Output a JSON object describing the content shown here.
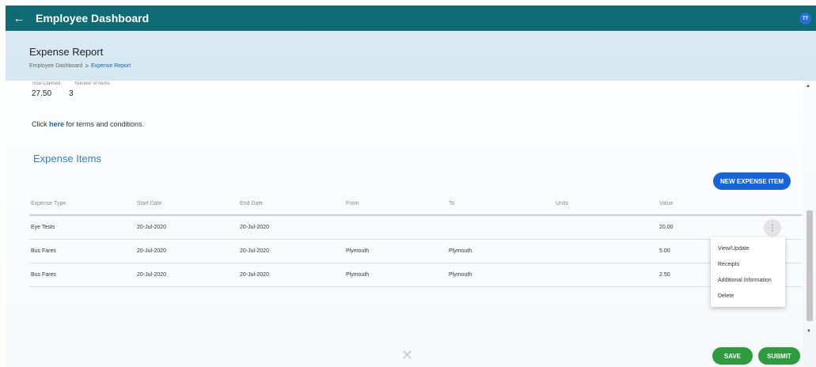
{
  "topbar": {
    "title": "Employee Dashboard",
    "back_icon": "←",
    "avatar_initials": "TT"
  },
  "page": {
    "title": "Expense Report",
    "breadcrumb": {
      "parent": "Employee Dashboard",
      "separator": ">",
      "current": "Expense Report"
    }
  },
  "totals": {
    "labels": [
      "Total Claimed",
      "Number of Items"
    ],
    "claimed": "27.50",
    "items": "3"
  },
  "terms": {
    "prefix": "Click ",
    "link": "here",
    "suffix": " for terms and conditions."
  },
  "section": {
    "title": "Expense Items"
  },
  "buttons": {
    "new_item": "NEW EXPENSE ITEM",
    "save": "SAVE",
    "submit": "SUBMIT"
  },
  "table": {
    "headers": [
      "Expense Type",
      "Start Date",
      "End Date",
      "From",
      "To",
      "Units",
      "Value"
    ],
    "rows": [
      [
        "Eye Tests",
        "20-Jul-2020",
        "20-Jul-2020",
        "",
        "",
        "",
        "20.00"
      ],
      [
        "Bus Fares",
        "20-Jul-2020",
        "20-Jul-2020",
        "Plymouth",
        "Plymouth",
        "",
        "5.00"
      ],
      [
        "Bus Fares",
        "20-Jul-2020",
        "20-Jul-2020",
        "Plymouth",
        "Plymouth",
        "",
        "2.50"
      ]
    ]
  },
  "row_menu": {
    "icon": "⋮",
    "items": [
      "View/Update",
      "Receipts",
      "Additional Information",
      "Delete"
    ]
  },
  "scrollbar": {
    "up": "▲",
    "down": "▼"
  },
  "colors": {
    "topbar": "#0f6b73",
    "primary": "#1565d8",
    "success": "#2e9b3e",
    "section_title": "#2f7fd0",
    "link": "#1565c0"
  }
}
